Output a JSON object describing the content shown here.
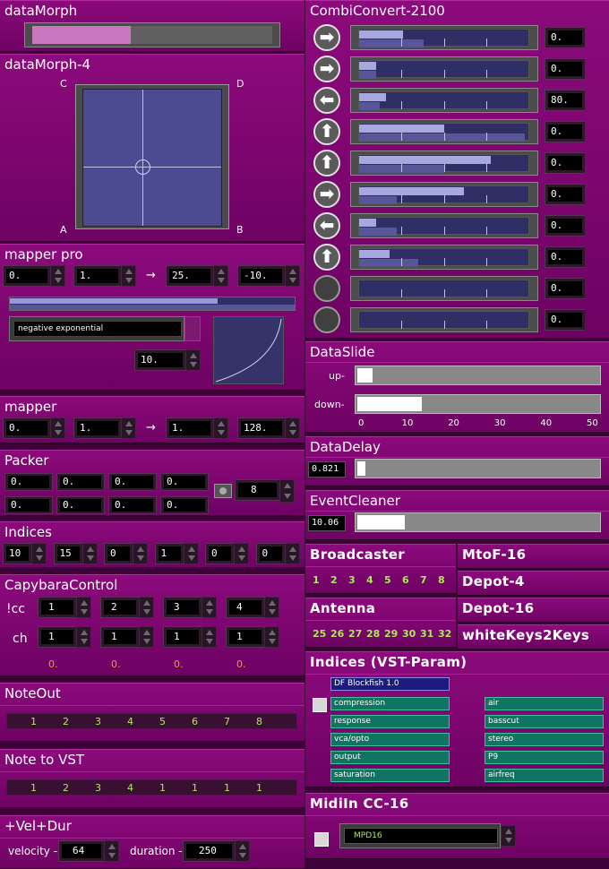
{
  "dataMorph": {
    "title": "dataMorph",
    "level": 0.41
  },
  "dataMorph4": {
    "title": "dataMorph-4",
    "corners": {
      "c": "C",
      "d": "D",
      "a": "A",
      "b": "B"
    }
  },
  "mapperPro": {
    "title": "mapper pro",
    "in_min": "0.",
    "in_max": "1.",
    "arrow": "→",
    "out_min": "25.",
    "out_max": "-10.",
    "curve": "negative exponential",
    "curve_param": "10."
  },
  "mapper": {
    "title": "mapper",
    "in_min": "0.",
    "in_max": "1.",
    "arrow": "→",
    "out_min": "1.",
    "out_max": "128."
  },
  "packer": {
    "title": "Packer",
    "row1": [
      "0.",
      "0.",
      "0.",
      "0."
    ],
    "row2": [
      "0.",
      "0.",
      "0.",
      "0."
    ],
    "count": "8"
  },
  "indices": {
    "title": "Indices",
    "values": [
      "10",
      "15",
      "0",
      "1",
      "0",
      "0"
    ]
  },
  "capybara": {
    "title": "CapybaraControl",
    "cc_label": "!cc",
    "ch_label": "ch",
    "cc": [
      "1",
      "2",
      "3",
      "4"
    ],
    "ch": [
      "1",
      "1",
      "1",
      "1"
    ],
    "out": [
      "0.",
      "0.",
      "0.",
      "0."
    ]
  },
  "noteOut": {
    "title": "NoteOut",
    "values": [
      "1",
      "2",
      "3",
      "4",
      "5",
      "6",
      "7",
      "8"
    ]
  },
  "noteToVst": {
    "title": "Note to VST",
    "values": [
      "1",
      "2",
      "3",
      "4",
      "1",
      "1",
      "1",
      "1"
    ]
  },
  "velDur": {
    "title": "+Vel+Dur",
    "velocity_label": "velocity -",
    "velocity": "64",
    "duration_label": "duration -",
    "duration": "250"
  },
  "combi": {
    "title": "CombiConvert-2100",
    "rows": [
      {
        "icon": "arrow-right",
        "glyph": "➡",
        "top": 0.26,
        "bottom": 0.38,
        "value": "0."
      },
      {
        "icon": "arrow-right",
        "glyph": "➡",
        "top": 0.1,
        "bottom": 0.1,
        "value": "0."
      },
      {
        "icon": "arrow-left",
        "glyph": "⬅",
        "top": 0.16,
        "bottom": 0.12,
        "value": "80."
      },
      {
        "icon": "arrow-up",
        "glyph": "⬆",
        "top": 0.5,
        "bottom": 0.98,
        "value": "0."
      },
      {
        "icon": "arrow-up",
        "glyph": "⬆",
        "top": 0.78,
        "bottom": 0.5,
        "value": "0."
      },
      {
        "icon": "arrow-right",
        "glyph": "➡",
        "top": 0.62,
        "bottom": 0.22,
        "value": "0."
      },
      {
        "icon": "arrow-left",
        "glyph": "⬅",
        "top": 0.1,
        "bottom": 0.22,
        "value": "0."
      },
      {
        "icon": "arrow-up",
        "glyph": "⬆",
        "top": 0.18,
        "bottom": 0.35,
        "value": "0."
      },
      {
        "icon": "circle",
        "glyph": "",
        "top": 0.0,
        "bottom": 0.0,
        "value": "0."
      },
      {
        "icon": "circle",
        "glyph": "",
        "top": 0.0,
        "bottom": 0.0,
        "value": "0."
      }
    ]
  },
  "dataSlide": {
    "title": "DataSlide",
    "up_label": "up-",
    "down_label": "down-",
    "up_level": 0.07,
    "down_level": 0.27,
    "ticks": [
      "0",
      "10",
      "20",
      "30",
      "40",
      "50"
    ]
  },
  "dataDelay": {
    "title": "DataDelay",
    "value": "0.821",
    "level": 0.04
  },
  "eventCleaner": {
    "title": "EventCleaner",
    "value": "10.06",
    "level": 0.2
  },
  "broadcaster": {
    "title": "Broadcaster",
    "values": [
      "1",
      "2",
      "3",
      "4",
      "5",
      "6",
      "7",
      "8"
    ]
  },
  "antenna": {
    "title": "Antenna",
    "values": [
      "25",
      "26",
      "27",
      "28",
      "29",
      "30",
      "31",
      "32"
    ]
  },
  "side": {
    "mtof": "MtoF-16",
    "depot4": "Depot-4",
    "depot16": "Depot-16",
    "whiteKeys": "whiteKeys2Keys"
  },
  "indicesVst": {
    "title": "Indices (VST-Param)",
    "plugin": "DF Blockfish 1.0",
    "left": [
      "compression",
      "response",
      "vca/opto",
      "output",
      "saturation"
    ],
    "right": [
      "air",
      "basscut",
      "stereo",
      "P9",
      "airfreq"
    ]
  },
  "midiIn": {
    "title": "MidiIn CC-16",
    "device": "MPD16"
  }
}
